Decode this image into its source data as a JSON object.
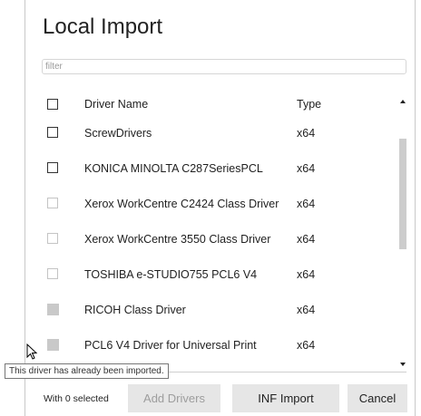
{
  "dialog": {
    "title": "Local Import",
    "filter_placeholder": "filter",
    "header": {
      "name": "Driver Name",
      "type": "Type"
    },
    "rows": [
      {
        "name": "ScrewDrivers",
        "type": "x64",
        "checkbox": "empty"
      },
      {
        "name": "KONICA MINOLTA C287SeriesPCL",
        "type": "x64",
        "checkbox": "empty"
      },
      {
        "name": "Xerox WorkCentre C2424 Class Driver",
        "type": "x64",
        "checkbox": "light"
      },
      {
        "name": "Xerox WorkCentre 3550 Class Driver",
        "type": "x64",
        "checkbox": "light"
      },
      {
        "name": "TOSHIBA e-STUDIO755 PCL6 V4",
        "type": "x64",
        "checkbox": "light"
      },
      {
        "name": "RICOH Class Driver",
        "type": "x64",
        "checkbox": "disabled-imported"
      },
      {
        "name": "PCL6 V4 Driver for Universal Print",
        "type": "x64",
        "checkbox": "disabled-imported"
      }
    ],
    "tooltip": "This driver has already been imported.",
    "footer": {
      "selected_info": "With 0 selected",
      "add_drivers": "Add Drivers",
      "inf_import": "INF Import",
      "cancel": "Cancel"
    }
  }
}
